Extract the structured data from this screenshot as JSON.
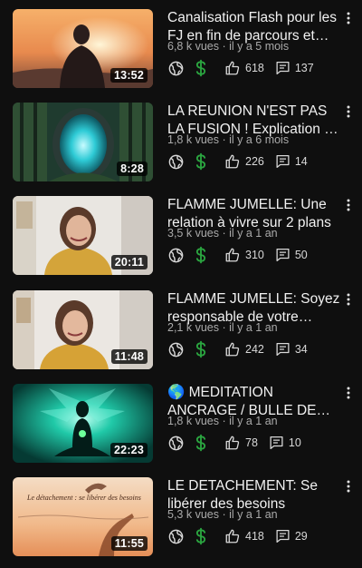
{
  "videos": [
    {
      "title": "Canalisation Flash pour les FJ en fin de parcours et plus...",
      "views": "6,8 k vues",
      "age": "il y a 5 mois",
      "duration": "13:52",
      "likes": "618",
      "comments": "137"
    },
    {
      "title": "LA REUNION N'EST PAS LA FUSION ! Explication et différence",
      "views": "1,8 k vues",
      "age": "il y a 6 mois",
      "duration": "8:28",
      "likes": "226",
      "comments": "14"
    },
    {
      "title": "FLAMME JUMELLE: Une relation à vivre sur 2 plans",
      "views": "3,5 k vues",
      "age": "il y a 1 an",
      "duration": "20:11",
      "likes": "310",
      "comments": "50"
    },
    {
      "title": "FLAMME JUMELLE: Soyez responsable de votre expérience",
      "views": "2,1 k vues",
      "age": "il y a 1 an",
      "duration": "11:48",
      "likes": "242",
      "comments": "34"
    },
    {
      "title": "🌎 MEDITATION ANCRAGE / BULLE DE PROTECTION",
      "views": "1,8 k vues",
      "age": "il y a 1 an",
      "duration": "22:23",
      "likes": "78",
      "comments": "10"
    },
    {
      "title": "LE DETACHEMENT: Se libérer des besoins",
      "views": "5,3 k vues",
      "age": "il y a 1 an",
      "duration": "11:55",
      "likes": "418",
      "comments": "29",
      "thumb_caption": "Le détachement : se libérer des besoins"
    }
  ],
  "separator": " · ",
  "icons": {
    "public": "globe-icon",
    "monetization": "dollar-icon",
    "likes": "thumbs-up-icon",
    "comments": "comment-icon",
    "menu": "more-vert-icon"
  },
  "colors": {
    "background": "#0f0f0f",
    "monetization": "#2ba640",
    "meta": "#aaaaaa"
  }
}
